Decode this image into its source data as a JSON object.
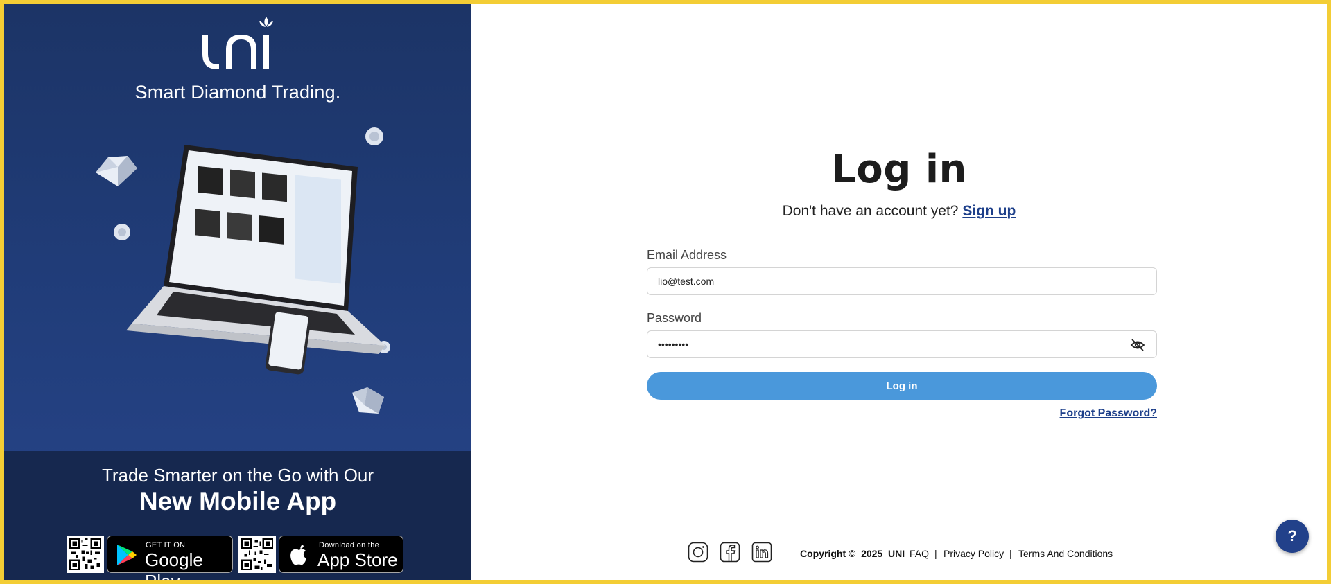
{
  "brand": {
    "logo_text": "uni",
    "tagline": "Smart Diamond Trading."
  },
  "promo": {
    "line1": "Trade Smarter on the Go with Our",
    "line2": "New Mobile App",
    "google_play": {
      "small": "GET IT ON",
      "big": "Google Play"
    },
    "app_store": {
      "small": "Download on the",
      "big": "App Store"
    }
  },
  "login": {
    "title": "Log in",
    "signup_prompt": "Don't have an account yet?",
    "signup_link": "Sign up",
    "email_label": "Email Address",
    "email_value": "lio@test.com",
    "password_label": "Password",
    "password_value": "123456789",
    "submit_label": "Log in",
    "forgot_link": "Forgot Password?"
  },
  "footer": {
    "social_icons": [
      "instagram-icon",
      "facebook-icon",
      "linkedin-icon"
    ],
    "copyright_prefix": "Copyright ©",
    "year": "2025",
    "company": "UNI",
    "links": [
      "FAQ",
      "Privacy Policy",
      "Terms And Conditions"
    ],
    "separator": "|"
  },
  "help": {
    "label": "?"
  },
  "colors": {
    "frame": "#f3cd35",
    "left_panel": "#203c78",
    "promo_band": "#16284f",
    "primary_button": "#4a98db",
    "link": "#1d3f8a",
    "help_button": "#22418a"
  }
}
